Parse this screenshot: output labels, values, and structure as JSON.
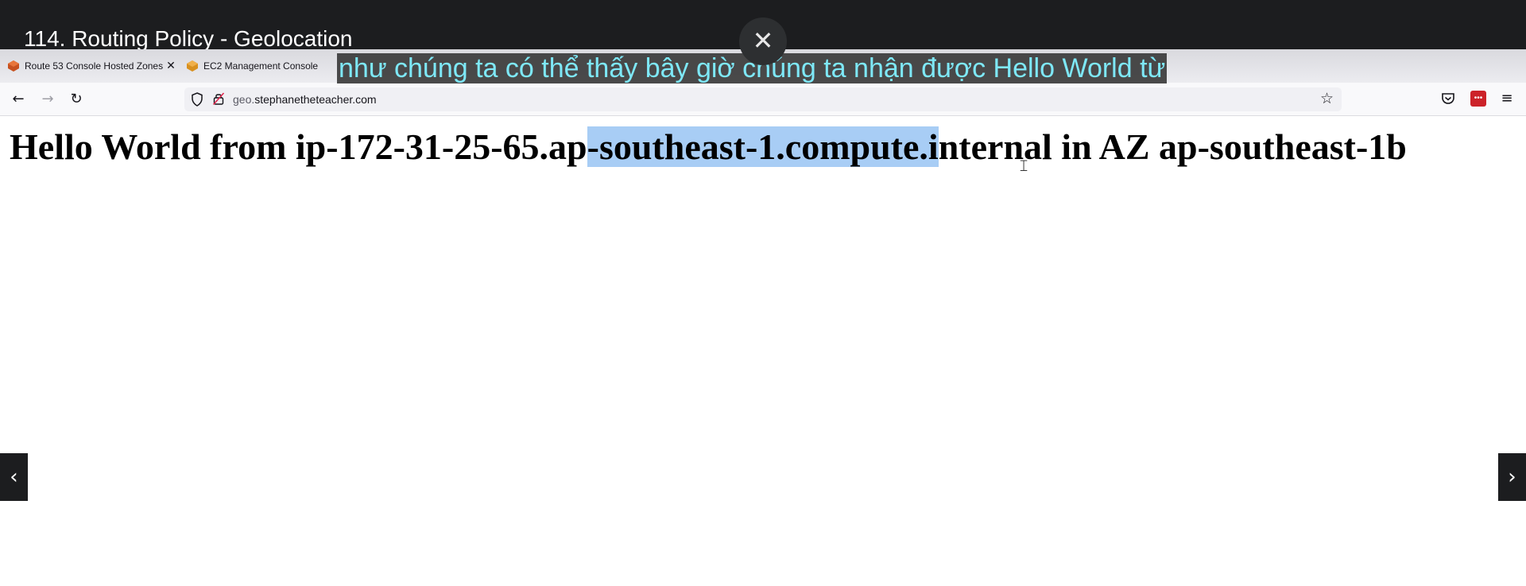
{
  "lecture": {
    "title": "114. Routing Policy - Geolocation",
    "close_glyph": "✕"
  },
  "browser": {
    "tabs": [
      {
        "label": "Route 53 Console Hosted Zones",
        "close_glyph": "✕",
        "icon": "aws-route53-icon",
        "color": "#c7511f"
      },
      {
        "label": "EC2 Management Console",
        "icon": "aws-ec2-icon",
        "color": "#d8901f"
      }
    ],
    "nav": {
      "back_glyph": "←",
      "forward_glyph": "→",
      "reload_glyph": "↻"
    },
    "url": {
      "prefix": "geo.",
      "domain": "stephanetheteacher.com"
    },
    "star_glyph": "☆",
    "menu_glyph": "≡",
    "extension_glyph": "•••"
  },
  "subtitle": {
    "text": "như chúng ta có thể thấy bây giờ chúng ta nhận được Hello World từ"
  },
  "page": {
    "heading_before": "Hello World from ip-172-31-25-65.ap",
    "heading_selected": "-southeast-1.compute.i",
    "heading_after": "nternal in AZ ap-southeast-1b",
    "selection_color": "#a8cdf5"
  },
  "player": {
    "prev_glyph": "‹",
    "next_glyph": "›"
  }
}
